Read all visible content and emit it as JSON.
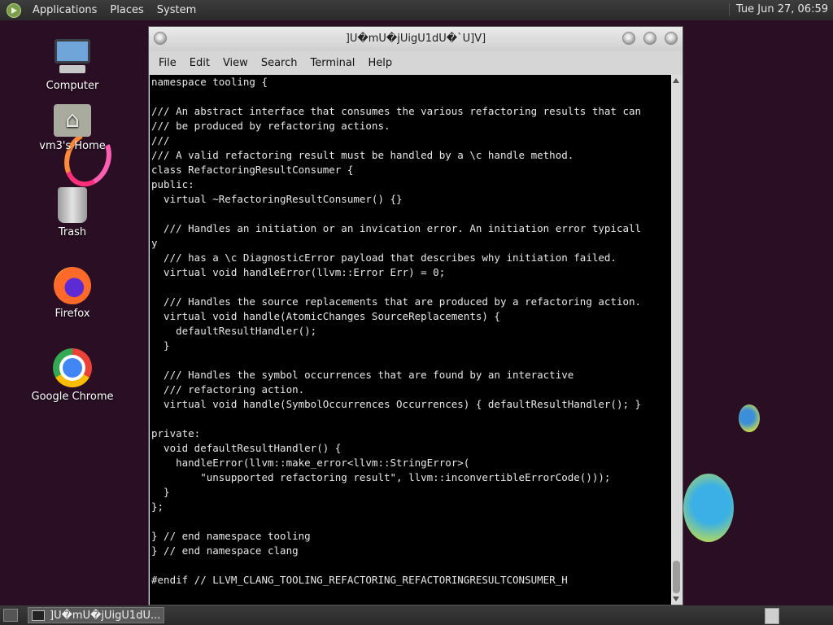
{
  "top_panel": {
    "menus": [
      "Applications",
      "Places",
      "System"
    ],
    "clock": "Tue Jun 27, 06:59"
  },
  "desktop_icons": [
    {
      "label": "Computer",
      "icon": "computer-icon"
    },
    {
      "label": "vm3's Home",
      "icon": "home-folder-icon"
    },
    {
      "label": "Trash",
      "icon": "trash-icon"
    },
    {
      "label": "Firefox",
      "icon": "firefox-icon"
    },
    {
      "label": "Google Chrome",
      "icon": "chrome-icon"
    }
  ],
  "window": {
    "title": "]U�mU�jUigU1dU�`U]V]",
    "menus": [
      "File",
      "Edit",
      "View",
      "Search",
      "Terminal",
      "Help"
    ],
    "terminal_text": "namespace tooling {\n\n/// An abstract interface that consumes the various refactoring results that can\n/// be produced by refactoring actions.\n///\n/// A valid refactoring result must be handled by a \\c handle method.\nclass RefactoringResultConsumer {\npublic:\n  virtual ~RefactoringResultConsumer() {}\n\n  /// Handles an initiation or an invication error. An initiation error typicall\ny\n  /// has a \\c DiagnosticError payload that describes why initiation failed.\n  virtual void handleError(llvm::Error Err) = 0;\n\n  /// Handles the source replacements that are produced by a refactoring action.\n  virtual void handle(AtomicChanges SourceReplacements) {\n    defaultResultHandler();\n  }\n\n  /// Handles the symbol occurrences that are found by an interactive\n  /// refactoring action.\n  virtual void handle(SymbolOccurrences Occurrences) { defaultResultHandler(); }\n\nprivate:\n  void defaultResultHandler() {\n    handleError(llvm::make_error<llvm::StringError>(\n        \"unsupported refactoring result\", llvm::inconvertibleErrorCode()));\n  }\n};\n\n} // end namespace tooling\n} // end namespace clang\n\n#endif // LLVM_CLANG_TOOLING_REFACTORING_REFACTORINGRESULTCONSUMER_H"
  },
  "taskbar": {
    "task_label": "]U�mU�jUigU1dU..."
  }
}
